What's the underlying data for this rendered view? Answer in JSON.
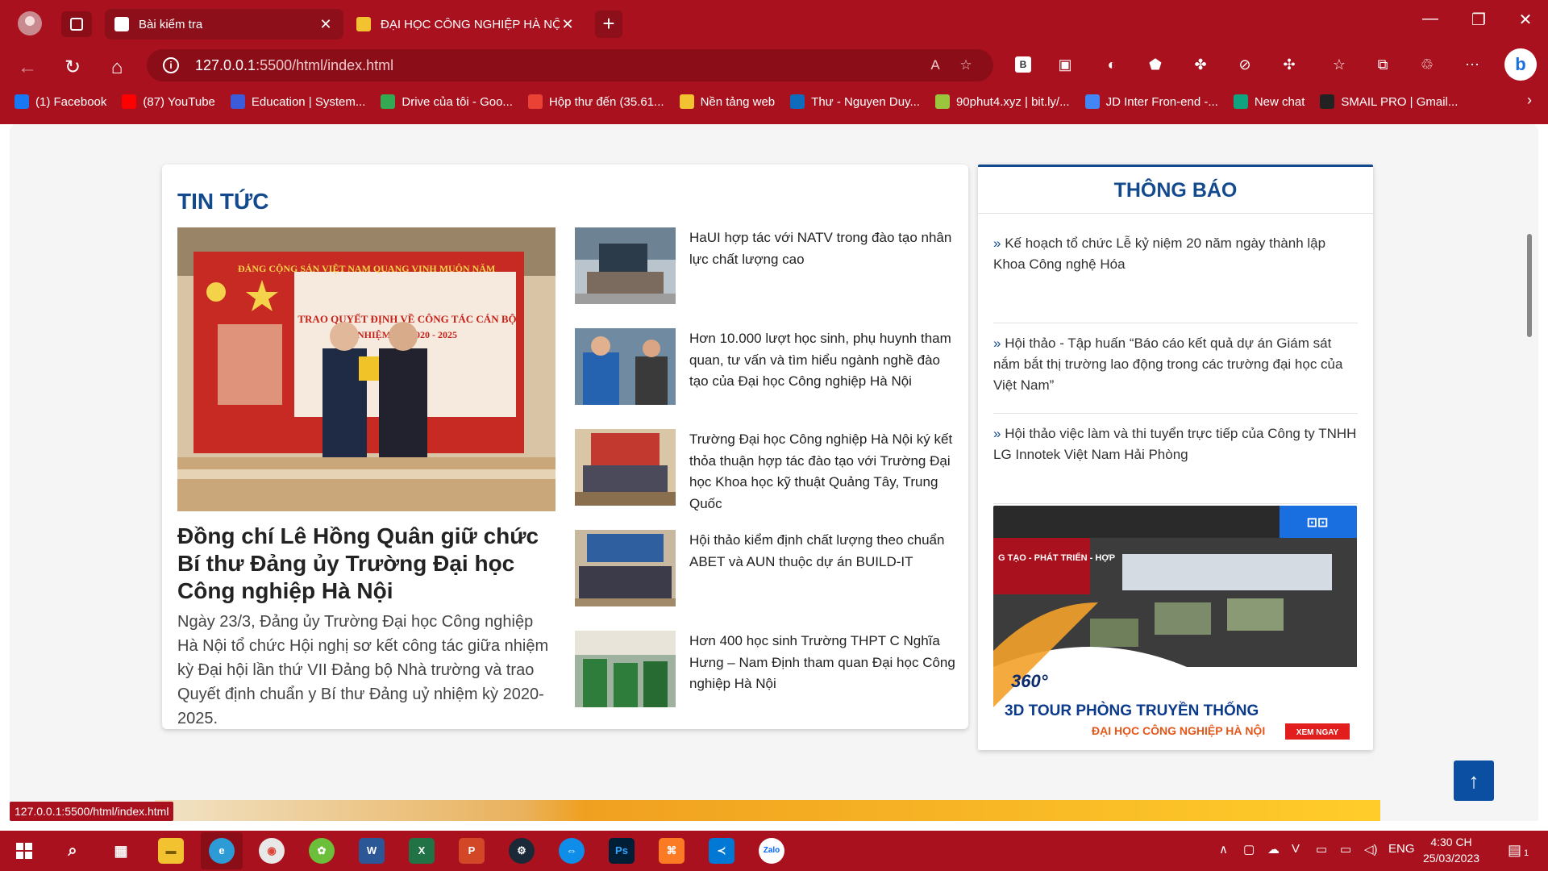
{
  "browser": {
    "tabs": [
      {
        "title": "Bài kiểm tra"
      },
      {
        "title": "ĐẠI HỌC CÔNG NGHIỆP HÀ NỘI"
      }
    ],
    "address": {
      "host": "127.0.0.1",
      "path": ":5500/html/index.html"
    },
    "bookmarks": [
      {
        "label": "(1) Facebook",
        "color": "#1877f2"
      },
      {
        "label": "(87) YouTube",
        "color": "#ff0000"
      },
      {
        "label": "Education | System...",
        "color": "#3b5bdb"
      },
      {
        "label": "Drive của tôi - Goo...",
        "color": "#34a853"
      },
      {
        "label": "Hộp thư đến (35.61...",
        "color": "#ea4335"
      },
      {
        "label": "Nền tảng web",
        "color": "#f2c230"
      },
      {
        "label": "Thư - Nguyen Duy...",
        "color": "#0f6cbd"
      },
      {
        "label": "90phut4.xyz | bit.ly/...",
        "color": "#9bc53d"
      },
      {
        "label": "JD Inter Fron-end -...",
        "color": "#4285f4"
      },
      {
        "label": "New chat",
        "color": "#10a37f"
      },
      {
        "label": "SMAIL PRO | Gmail...",
        "color": "#222222"
      }
    ]
  },
  "page": {
    "news": {
      "section_title": "TIN TỨC",
      "feature": {
        "headline": "Đồng chí Lê Hồng Quân giữ chức Bí thư Đảng ủy Trường Đại học Công nghiệp Hà Nội",
        "summary": "Ngày 23/3, Đảng ủy Trường Đại học Công nghiệp Hà Nội tổ chức Hội nghị sơ kết công tác giữa nhiệm kỳ Đại hội lần thứ VII Đảng bộ Nhà trường và trao Quyết định chuẩn y Bí thư Đảng uỷ nhiệm kỳ 2020-2025.",
        "banner_top": "ĐẢNG CỘNG SẢN VIỆT NAM QUANG VINH MUÔN NĂM",
        "banner_main": "TRAO QUYẾT ĐỊNH VỀ CÔNG TÁC CÁN BỘ",
        "banner_term": "NHIỆM KỲ 2020 - 2025"
      },
      "items": [
        {
          "title": "HaUI hợp tác với NATV trong đào tạo nhân lực chất lượng cao"
        },
        {
          "title": "Hơn 10.000 lượt học sinh, phụ huynh tham quan, tư vấn và tìm hiểu ngành nghề đào tạo của Đại học Công nghiệp Hà Nội"
        },
        {
          "title": "Trường Đại học Công nghiệp Hà Nội ký kết thỏa thuận hợp tác đào tạo với Trường Đại học Khoa học kỹ thuật Quảng Tây, Trung Quốc"
        },
        {
          "title": "Hội thảo kiểm định chất lượng theo chuẩn ABET và AUN thuộc dự án BUILD-IT"
        },
        {
          "title": "Hơn 400 học sinh Trường THPT C Nghĩa Hưng – Nam Định tham quan Đại học Công nghiệp Hà Nội"
        }
      ]
    },
    "notices": {
      "title": "THÔNG BÁO",
      "items": [
        {
          "text": "Kế hoạch tổ chức Lễ kỷ niệm 20 năm ngày thành lập Khoa Công nghệ Hóa"
        },
        {
          "text": "Hội thảo - Tập huấn “Báo cáo kết quả dự án Giám sát nắm bắt thị trường lao động trong các trường đại học của Việt Nam”"
        },
        {
          "text": "Hội thảo việc làm và thi tuyển trực tiếp của Công ty TNHH LG Innotek Việt Nam Hải Phòng"
        }
      ],
      "tour": {
        "badge": "360°",
        "line1": "3D TOUR PHÒNG TRUYỀN THỐNG",
        "line2": "ĐẠI HỌC CÔNG NGHIỆP HÀ NỘI",
        "cta": "XEM NGAY",
        "wall_text": "G TẠO - PHÁT TRIỂN - HỢP"
      }
    },
    "status_url": "127.0.0.1:5500/html/index.html"
  },
  "taskbar": {
    "language": "ENG",
    "time": "4:30 CH",
    "date": "25/03/2023",
    "notification_count": "1"
  }
}
